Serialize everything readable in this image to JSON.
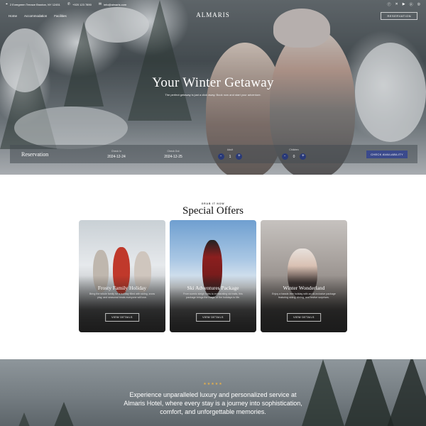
{
  "topbar": {
    "address": "2 Evergreen Terrace Braxton, NY 12451",
    "phone": "+920 123 7890",
    "email": "info@almaris.com",
    "socials": [
      "facebook-icon",
      "x-icon",
      "youtube-icon",
      "pinterest-icon",
      "instagram-icon"
    ]
  },
  "nav": {
    "links": [
      "Home",
      "Accommodation",
      "Facilities"
    ],
    "logo": "ALMARIS",
    "reservation_button": "RESERVATION"
  },
  "hero": {
    "title": "Your Winter Getaway",
    "subtitle": "The perfect getaway is just a click away. Book now and start your adventure."
  },
  "reservation_bar": {
    "label": "Reservation",
    "check_in_label": "Check In",
    "check_in_value": "2024-12-24",
    "check_out_label": "Check Out",
    "check_out_value": "2024-12-25",
    "adult_label": "Adult",
    "adult_value": "1",
    "children_label": "Children",
    "children_value": "0",
    "minus": "-",
    "plus": "+",
    "button": "CHECK AVAILABILITY"
  },
  "offers": {
    "eyebrow": "GRAB IT NOW",
    "title": "Special Offers",
    "cards": [
      {
        "title": "Frosty Family Holiday",
        "desc": "Bring the whole family for a holiday filled with skiing, snow play, and seasonal treats everyone will love.",
        "button": "VIEW DETAILS"
      },
      {
        "title": "Ski Adventures Package",
        "desc": "From scenic sleigh rides to exhilarating ski trails, this package brings the magic of the holidays to life.",
        "button": "VIEW DETAILS"
      },
      {
        "title": "Winter Wonderland",
        "desc": "Enjoy a hassle-free holiday with an all-inclusive package featuring skiing, dining, and festive surprises.",
        "button": "VIEW DETAILS"
      }
    ]
  },
  "testimonial": {
    "stars": "★★★★★",
    "quote": "Experience unparalleled luxury and personalized service at Almaris Hotel, where every stay is a journey into sophistication, comfort, and unforgettable memories."
  },
  "colors": {
    "accent": "#3b4a8c",
    "stepper": "#2a3a78",
    "star": "#e5b04a"
  }
}
